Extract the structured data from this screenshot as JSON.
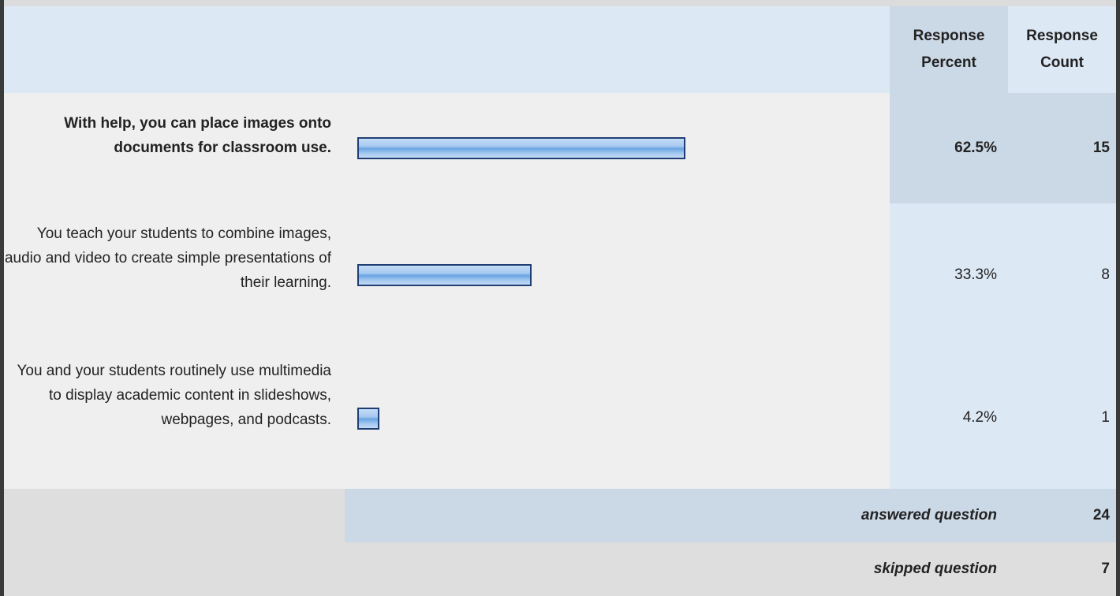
{
  "header": {
    "response_percent": [
      "Response",
      "Percent"
    ],
    "response_count": [
      "Response",
      "Count"
    ]
  },
  "chart_data": {
    "type": "bar",
    "orientation": "horizontal",
    "categories": [
      "With help, you can place images onto documents for classroom use.",
      "You teach your students to combine images, audio and video to create simple presentations of their learning.",
      "You and your students routinely use multimedia to display academic content in slideshows, webpages, and podcasts."
    ],
    "values": [
      62.5,
      33.3,
      4.2
    ],
    "percent_labels": [
      "62.5%",
      "33.3%",
      "4.2%"
    ],
    "counts": [
      "15",
      "8",
      "1"
    ],
    "highlighted_index": 0,
    "xlim": [
      0,
      100
    ],
    "bar_color": "#8dbbec",
    "bar_border_color": "#1f3f74"
  },
  "summary": {
    "answered_label": "answered question",
    "answered_value": "24",
    "skipped_label": "skipped question",
    "skipped_value": "7"
  },
  "colors": {
    "header_bg": "#dde8f5",
    "highlight_col_bg": "#cbd8e6",
    "row_bg": "#efefef",
    "footer_bg": "#dedede"
  }
}
